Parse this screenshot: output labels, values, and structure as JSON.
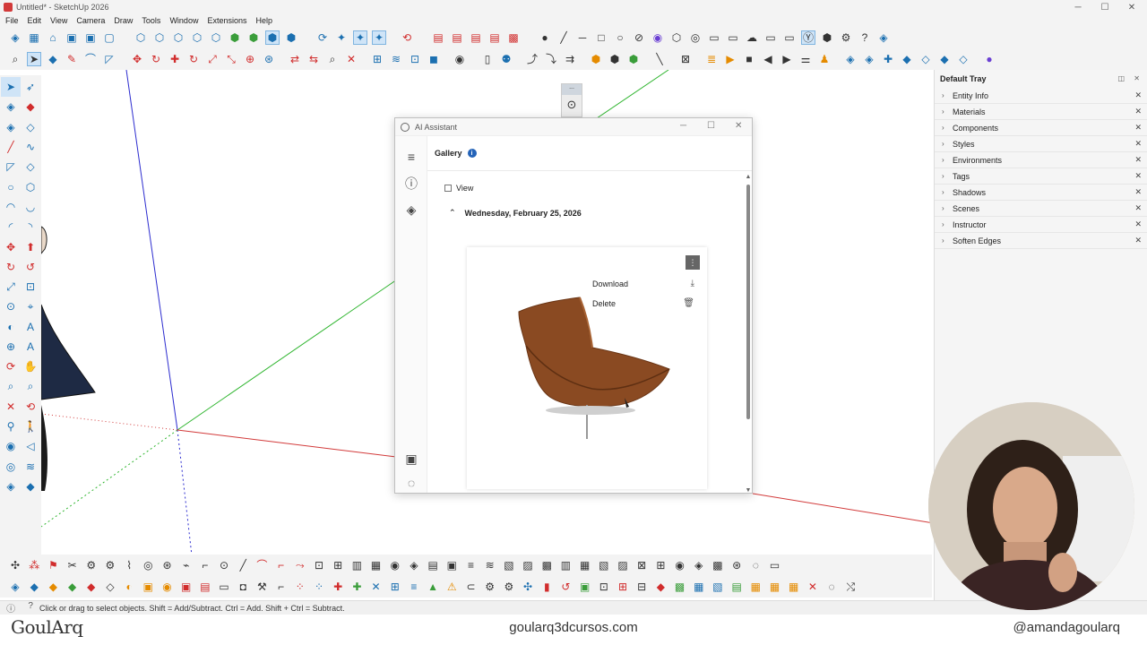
{
  "window": {
    "title": "Untitled* - SketchUp 2026",
    "controls": {
      "minimize": "─",
      "maximize": "☐",
      "close": "✕"
    }
  },
  "menu": [
    "File",
    "Edit",
    "View",
    "Camera",
    "Draw",
    "Tools",
    "Window",
    "Extensions",
    "Help"
  ],
  "ai_assistant": {
    "title": "AI Assistant",
    "controls": {
      "minimize": "─",
      "maximize": "☐",
      "close": "✕"
    },
    "gallery_label": "Gallery",
    "info_icon": "i",
    "view_label": "View",
    "date_label": "Wednesday, February 25, 2026",
    "caret": "⌃",
    "menu_items": [
      {
        "label": "Download",
        "icon": "⤓"
      },
      {
        "label": "Delete",
        "icon": "🗑"
      }
    ],
    "kebab": "⋮"
  },
  "tray": {
    "title": "Default Tray",
    "header_buttons": "◫ ✕",
    "items": [
      "Entity Info",
      "Materials",
      "Components",
      "Styles",
      "Environments",
      "Tags",
      "Shadows",
      "Scenes",
      "Instructor",
      "Soften Edges"
    ],
    "chevron": "›",
    "close": "✕"
  },
  "mini_panel": {
    "label": "..."
  },
  "status": {
    "text": "Click or drag to select objects. Shift = Add/Subtract. Ctrl = Add. Shift + Ctrl = Subtract.",
    "icons": [
      "ⓘ",
      "?"
    ]
  },
  "footer": {
    "brand": "GoulArq",
    "site": "goularq3dcursos.com",
    "handle": "@amandagoularq"
  },
  "colors": {
    "axis_red": "#d23a3a",
    "axis_green": "#2fb52f",
    "axis_blue": "#2c2ccf",
    "chair_leather": "#8a4a22",
    "accent_blue": "#2463b8"
  },
  "icons": {
    "toolbar1": [
      "component-icon",
      "shapes-icon",
      "house-icon",
      "box-icon",
      "box-icon",
      "box-icon",
      "cube-icon",
      "cube-icon",
      "cube-icon",
      "cube-icon",
      "cube-icon",
      "cube-icon",
      "cube-icon",
      "cube-icon",
      "cube-icon",
      "orbit-icon",
      "orbit-icon",
      "orbit-icon",
      "orbit-icon",
      "warehouse-icon",
      "layout-icon",
      "layout-icon",
      "layout-icon",
      "layout-icon",
      "layout-icon",
      "dot-icon",
      "line-icon",
      "line-icon",
      "square-icon",
      "circle-icon",
      "eye-off-icon",
      "purple-icon",
      "cube-icon",
      "cube-icon",
      "photo-icon",
      "photo-icon",
      "photo-icon",
      "photo-icon",
      "sun-icon",
      "cube-icon",
      "gear-icon",
      "help-icon",
      "cube-icon"
    ],
    "toolbar2": [
      "search-icon",
      "select-icon",
      "eraser-icon",
      "pencil-icon",
      "line-icon",
      "rect-icon",
      "move-icon",
      "rotate-icon",
      "scale-icon",
      "offset-icon",
      "tape-icon",
      "text-icon",
      "axes-icon",
      "section-icon",
      "section-icon",
      "section-icon",
      "walk-icon",
      "camera-icon",
      "user-icon",
      "doc-icon",
      "user-icon",
      "arrow-icon",
      "arrow-icon",
      "arrow-icon",
      "sandbox-icon",
      "sandbox-icon",
      "sandbox-icon",
      "pencil-icon",
      "grid-icon",
      "orange-icon",
      "play-icon",
      "stop-icon",
      "stop-icon",
      "stop-icon",
      "stop-icon",
      "cube-icon",
      "cube-icon",
      "cube-icon",
      "cube-icon",
      "cube-icon",
      "cube-icon",
      "ai-icon"
    ]
  }
}
